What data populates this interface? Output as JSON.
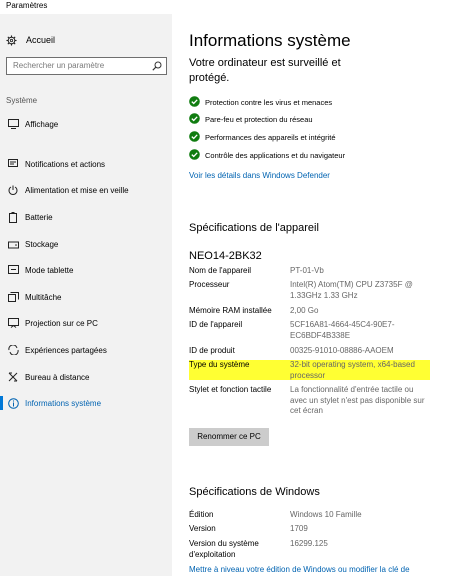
{
  "window": {
    "title": "Paramètres"
  },
  "sidebar": {
    "home_label": "Accueil",
    "search_placeholder": "Rechercher un paramètre",
    "group_label": "Système",
    "items": [
      {
        "label": "Affichage",
        "icon": "display-icon"
      },
      {
        "label": "Notifications et actions",
        "icon": "notifications-icon"
      },
      {
        "label": "Alimentation et mise en veille",
        "icon": "power-icon"
      },
      {
        "label": "Batterie",
        "icon": "battery-icon"
      },
      {
        "label": "Stockage",
        "icon": "storage-icon"
      },
      {
        "label": "Mode tablette",
        "icon": "tablet-icon"
      },
      {
        "label": "Multitâche",
        "icon": "multitask-icon"
      },
      {
        "label": "Projection sur ce PC",
        "icon": "projection-icon"
      },
      {
        "label": "Expériences partagées",
        "icon": "shared-icon"
      },
      {
        "label": "Bureau à distance",
        "icon": "remote-desktop-icon"
      },
      {
        "label": "Informations système",
        "icon": "info-icon",
        "active": true
      }
    ]
  },
  "main": {
    "title": "Informations système",
    "monitor_text": "Votre ordinateur est surveillé et protégé.",
    "protections": [
      "Protection contre les virus et menaces",
      "Pare-feu et protection du réseau",
      "Performances des appareils et intégrité",
      "Contrôle des applications et du navigateur"
    ],
    "defender_link": "Voir les détails dans Windows Defender",
    "device_specs_title": "Spécifications de l'appareil",
    "device_name": "NEO14-2BK32",
    "specs": {
      "nom_k": "Nom de l'appareil",
      "nom_v": "PT-01-Vb",
      "proc_k": "Processeur",
      "proc_v": "Intel(R) Atom(TM) CPU Z3735F @ 1.33GHz 1.33 GHz",
      "ram_k": "Mémoire RAM installée",
      "ram_v": "2,00 Go",
      "id_k": "ID de l'appareil",
      "id_v": "5CF16A81-4664-45C4-90E7-EC6BDF4B338E",
      "prod_k": "ID de produit",
      "prod_v": "00325-91010-08886-AAOEM",
      "type_k": "Type du système",
      "type_v": "32-bit operating system, x64-based processor",
      "pen_k": "Stylet et fonction tactile",
      "pen_v": "La fonctionnalité d'entrée tactile ou avec un stylet n'est pas disponible sur cet écran"
    },
    "highlight_color": "#ffff33",
    "rename_button": "Renommer ce PC",
    "windows_specs_title": "Spécifications de Windows",
    "win": {
      "ed_k": "Édition",
      "ed_v": "Windows 10 Famille",
      "ver_k": "Version",
      "ver_v": "1709",
      "os_k": "Version du système d'exploitation",
      "os_v": "16299.125"
    },
    "upgrade_link": "Mettre à niveau votre édition de Windows ou modifier la clé de"
  }
}
